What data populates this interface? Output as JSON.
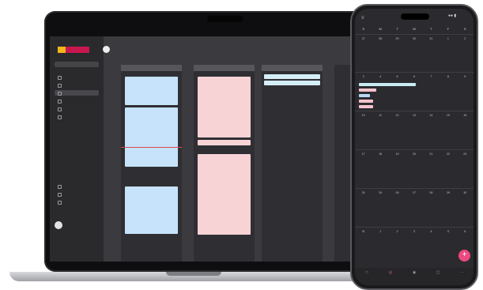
{
  "laptop": {
    "brand_text": "",
    "workspace": "",
    "nav": [
      {
        "label": "",
        "active": false
      },
      {
        "label": "",
        "active": false
      },
      {
        "label": "",
        "active": true
      },
      {
        "label": "",
        "active": false
      },
      {
        "label": "",
        "active": false
      },
      {
        "label": "",
        "active": false
      }
    ],
    "nav_bottom": [
      {
        "label": ""
      },
      {
        "label": ""
      },
      {
        "label": ""
      }
    ],
    "user_name": "",
    "page_title": "",
    "date_range": "",
    "columns": [
      {
        "label": ""
      },
      {
        "label": ""
      },
      {
        "label": ""
      }
    ]
  },
  "phone": {
    "status_time": "",
    "weekdays": [
      "S",
      "M",
      "T",
      "W",
      "T",
      "F",
      "S"
    ],
    "weeks": [
      [
        "27",
        "28",
        "29",
        "30",
        "31",
        "1",
        "2"
      ],
      [
        "3",
        "4",
        "5",
        "6",
        "7",
        "8",
        "9"
      ],
      [
        "10",
        "11",
        "12",
        "13",
        "14",
        "15",
        "16"
      ],
      [
        "17",
        "18",
        "19",
        "20",
        "21",
        "22",
        "23"
      ],
      [
        "24",
        "25",
        "26",
        "27",
        "28",
        "29",
        "30"
      ],
      [
        "31",
        "1",
        "2",
        "3",
        "4",
        "5",
        "6"
      ]
    ],
    "fab_label": "+",
    "tabs": [
      {
        "label": "",
        "icon": "calendar-icon",
        "active": false
      },
      {
        "label": "",
        "icon": "schedule-icon",
        "active": true
      },
      {
        "label": "",
        "icon": "groups-icon",
        "active": false
      },
      {
        "label": "",
        "icon": "chat-icon",
        "active": false
      },
      {
        "label": "",
        "icon": "more-icon",
        "active": false
      }
    ]
  },
  "colors": {
    "brand_yellow": "#f2b51a",
    "brand_red": "#c8174f",
    "event_blue": "#c7e2fb",
    "event_pink": "#f8d3d6",
    "accent_pink": "#ec4a7e"
  }
}
